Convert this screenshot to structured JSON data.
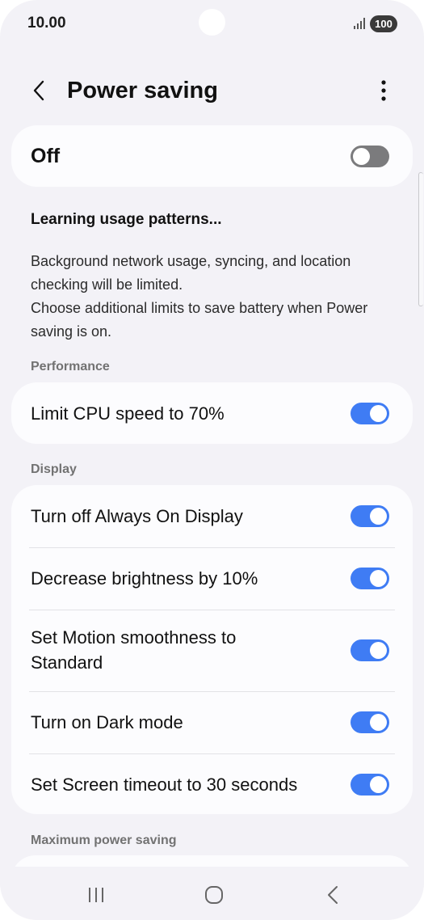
{
  "status_bar": {
    "time": "10.00",
    "battery": "100"
  },
  "app_bar": {
    "title": "Power saving"
  },
  "main_toggle": {
    "label": "Off",
    "state": "off"
  },
  "info": {
    "heading": "Learning usage patterns...",
    "text_1": "Background network usage, syncing, and location checking will be limited.",
    "text_2": "Choose additional limits to save battery when Power saving is on."
  },
  "sections": {
    "performance": "Performance",
    "display": "Display",
    "maximum": "Maximum power saving"
  },
  "performance_items": [
    {
      "label": "Limit CPU speed to 70%",
      "enabled": true
    }
  ],
  "display_items": [
    {
      "label": "Turn off Always On Display",
      "enabled": true
    },
    {
      "label": "Decrease brightness by 10%",
      "enabled": true
    },
    {
      "label": "Set Motion smoothness to Standard",
      "enabled": true
    },
    {
      "label": "Turn on Dark mode",
      "enabled": true
    },
    {
      "label": "Set Screen timeout to 30 seconds",
      "enabled": true
    }
  ],
  "colors": {
    "toggle_on": "#3f7cf4",
    "toggle_off": "#7b7b7d",
    "background": "#f3f2f7",
    "card": "#fcfcfe"
  }
}
